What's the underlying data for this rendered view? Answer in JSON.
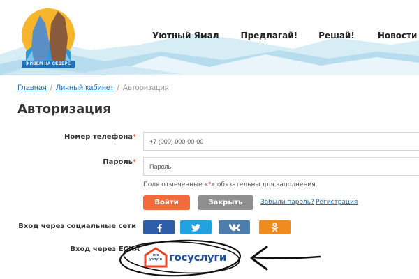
{
  "header": {
    "logo_text": "ЖИВЁМ НА СЕВЕРЕ",
    "nav": [
      "Уютный Ямал",
      "Предлагай!",
      "Решай!",
      "Новости"
    ]
  },
  "breadcrumb": {
    "home": "Главная",
    "cabinet": "Личный кабинет",
    "current": "Авторизация",
    "separator": "/"
  },
  "page_title": "Авторизация",
  "form": {
    "phone_label": "Номер телефона",
    "phone_placeholder": "+7 (000) 000-00-00",
    "password_label": "Пароль",
    "password_placeholder": "Пароль",
    "required_mark": "*",
    "required_note_before": "Поля отмеченные «",
    "required_note_after": "» обязательны для заполнения.",
    "login_button": "Войти",
    "close_button": "Закрыть",
    "forgot_link": "Забыли пароль?",
    "register_link": "Регистрация"
  },
  "social": {
    "label": "Вход через социальные сети",
    "items": [
      "facebook-icon",
      "twitter-icon",
      "vk-icon",
      "odnoklassniki-icon"
    ]
  },
  "esia": {
    "label": "Вход через ЕСИА",
    "logo_small": "гос услуги",
    "logo_text": "госуслуги"
  },
  "colors": {
    "accent": "#1e6fb8",
    "login": "#f26b3a",
    "close": "#8f8f8f",
    "facebook": "#2f5ea8",
    "twitter": "#23a2e2",
    "vk": "#4e7cab",
    "ok": "#ef8a1f",
    "gos_red": "#e4452b"
  }
}
